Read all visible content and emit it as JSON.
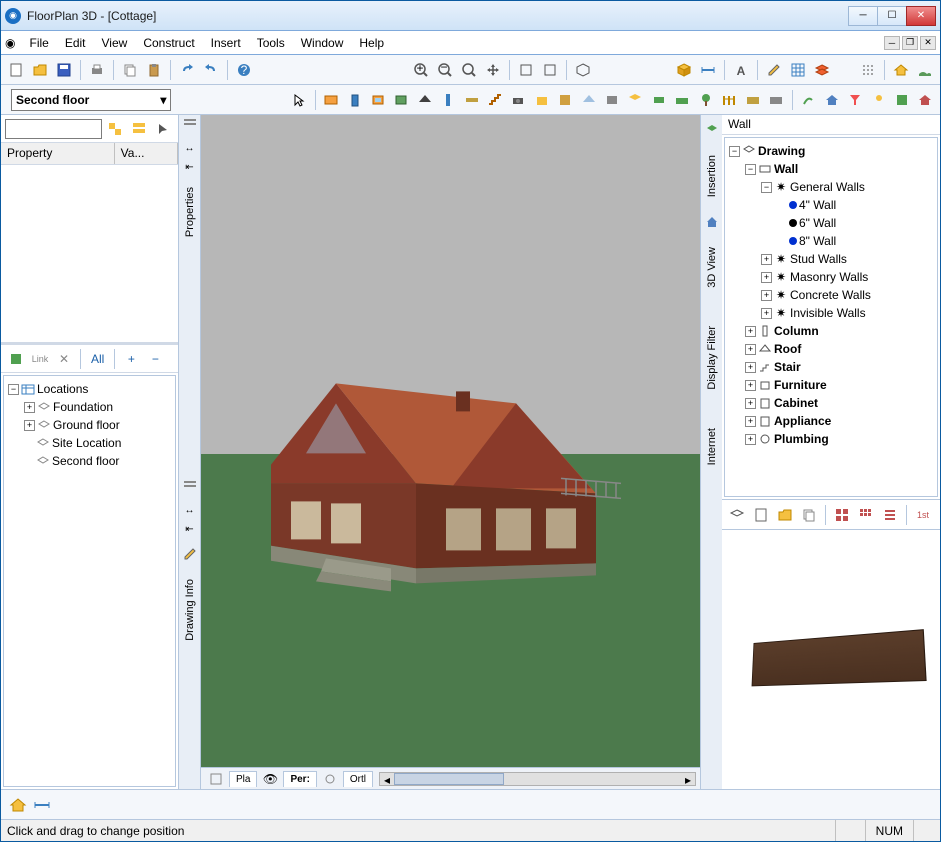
{
  "window": {
    "title": "FloorPlan 3D - [Cottage]"
  },
  "menu": {
    "file": "File",
    "edit": "Edit",
    "view": "View",
    "construct": "Construct",
    "insert": "Insert",
    "tools": "Tools",
    "window": "Window",
    "help": "Help"
  },
  "floor_selector": {
    "value": "Second floor"
  },
  "properties": {
    "col_property": "Property",
    "col_value": "Va..."
  },
  "locations": {
    "root": "Locations",
    "items": [
      "Foundation",
      "Ground floor",
      "Site Location",
      "Second floor"
    ]
  },
  "left_toolbar_filter": "All",
  "sidetabs_left": {
    "properties": "Properties",
    "drawing_info": "Drawing Info"
  },
  "sidetabs_right": {
    "insertion": "Insertion",
    "view3d": "3D View",
    "display_filter": "Display Filter",
    "internet": "Internet"
  },
  "view_tabs": {
    "plan": "Pla",
    "pers": "Per:",
    "ortho": "Ortl"
  },
  "right_panel": {
    "header": "Wall",
    "tree": {
      "drawing": "Drawing",
      "wall": "Wall",
      "general_walls": "General Walls",
      "wall_4": "4\" Wall",
      "wall_6": "6\" Wall",
      "wall_8": "8\" Wall",
      "stud_walls": "Stud Walls",
      "masonry_walls": "Masonry Walls",
      "concrete_walls": "Concrete Walls",
      "invisible_walls": "Invisible Walls",
      "column": "Column",
      "roof": "Roof",
      "stair": "Stair",
      "furniture": "Furniture",
      "cabinet": "Cabinet",
      "appliance": "Appliance",
      "plumbing": "Plumbing"
    }
  },
  "status": {
    "message": "Click and drag to change position",
    "num": "NUM"
  }
}
